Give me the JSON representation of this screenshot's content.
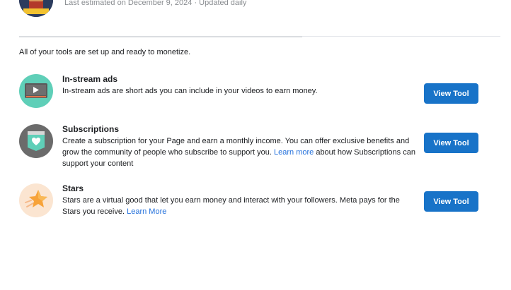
{
  "header": {
    "estimate_text": "Last estimated on December 9, 2024 · Updated daily"
  },
  "intro": "All of your tools are set up and ready to monetize.",
  "tools": [
    {
      "title": "In-stream ads",
      "description": "In-stream ads are short ads you can include in your videos to earn money.",
      "button": "View Tool",
      "icon": "video-play-icon",
      "icon_bg": "#5fcfb8"
    },
    {
      "title": "Subscriptions",
      "description_before": "Create a subscription for your Page and earn a monthly income. You can offer exclusive benefits and grow the community of people who subscribe to support you. ",
      "link": "Learn more",
      "description_after": " about how Subscriptions can support your content",
      "button": "View Tool",
      "icon": "heart-badge-icon",
      "icon_bg": "#6b6b6b"
    },
    {
      "title": "Stars",
      "description_before": "Stars are a virtual good that let you earn money and interact with your followers. Meta pays for the Stars you receive. ",
      "link": "Learn More",
      "button": "View Tool",
      "icon": "star-icon",
      "icon_bg": "#fbe5d1"
    }
  ],
  "colors": {
    "button_bg": "#1873c8",
    "link": "#216fdb"
  }
}
